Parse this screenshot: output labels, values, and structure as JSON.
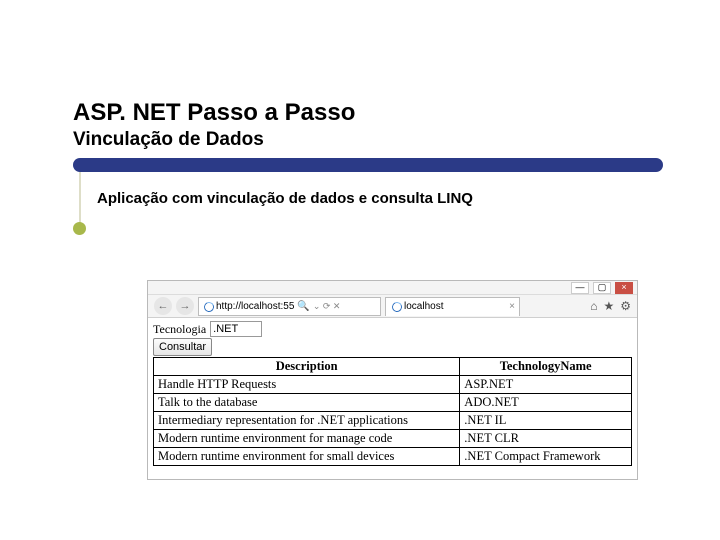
{
  "title": {
    "line1": "ASP. NET Passo a Passo",
    "line2": "Vinculação de Dados"
  },
  "body": "Aplicação com vinculação de dados e consulta LINQ",
  "browser": {
    "win": {
      "min": "—",
      "max": "▢",
      "close": "×"
    },
    "nav": {
      "back": "←",
      "fwd": "→"
    },
    "address": "http://localhost:55",
    "addr_suffix": "⌄ ⟳ ✕",
    "tab_label": "localhost",
    "tab_close": "×",
    "right": {
      "home": "⌂",
      "star": "★",
      "gear": "⚙"
    },
    "form": {
      "label": "Tecnologia",
      "value": ".NET",
      "btn": "Consultar"
    },
    "cols": {
      "desc": "Description",
      "tech": "TechnologyName"
    },
    "rows": [
      {
        "desc": "Handle HTTP Requests",
        "tech": "ASP.NET"
      },
      {
        "desc": "Talk to the database",
        "tech": "ADO.NET"
      },
      {
        "desc": "Intermediary representation for .NET applications",
        "tech": ".NET IL"
      },
      {
        "desc": "Modern runtime environment for manage code",
        "tech": ".NET CLR"
      },
      {
        "desc": "Modern runtime environment for small devices",
        "tech": ".NET Compact Framework"
      }
    ]
  }
}
